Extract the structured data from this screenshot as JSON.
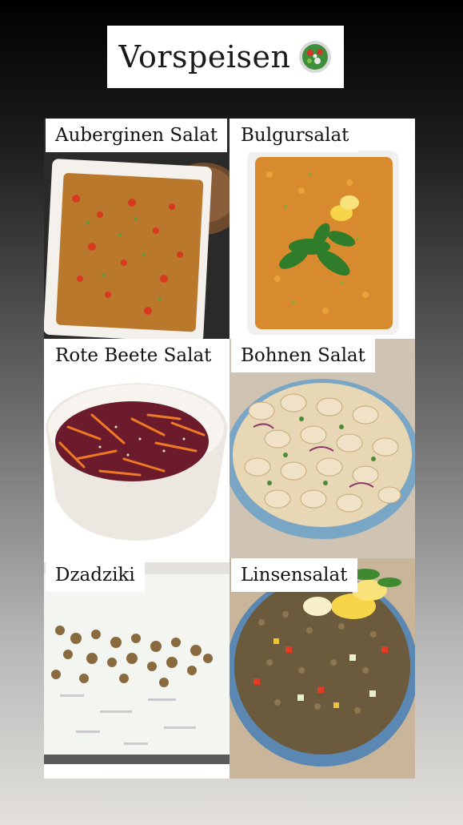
{
  "title": "Vorspeisen",
  "title_icon": "salad-bowl-icon",
  "dishes": [
    {
      "label": "Auberginen Salat"
    },
    {
      "label": "Bulgursalat"
    },
    {
      "label": "Rote Beete Salat"
    },
    {
      "label": "Bohnen Salat"
    },
    {
      "label": "Dzadziki"
    },
    {
      "label": "Linsensalat"
    }
  ],
  "colors": {
    "background_top": "#000000",
    "background_bottom": "#e4e1dc",
    "label_background": "#ffffff",
    "label_text": "#111111"
  }
}
